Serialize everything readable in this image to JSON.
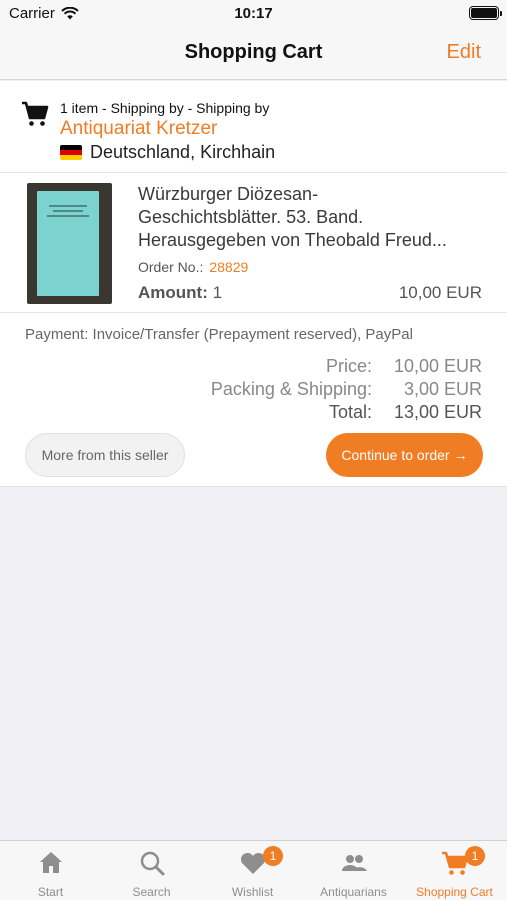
{
  "status_bar": {
    "carrier": "Carrier",
    "time": "10:17"
  },
  "nav": {
    "title": "Shopping Cart",
    "edit_label": "Edit"
  },
  "seller": {
    "summary": "1 item - Shipping by - Shipping by",
    "name": "Antiquariat Kretzer",
    "location": "Deutschland, Kirchhain",
    "flag_colors": [
      "#000000",
      "#dd0000",
      "#ffce00"
    ]
  },
  "item": {
    "title_lines": [
      "Würzburger Diözesan-",
      "Geschichtsblätter. 53. Band.",
      "Herausgegeben von Theobald Freud..."
    ],
    "order_label": "Order No.:",
    "order_number": "28829",
    "amount_label": "Amount:",
    "amount_value": "1",
    "price": "10,00 EUR",
    "cover_color": "#7dd3d0"
  },
  "payment": {
    "text": "Payment: Invoice/Transfer (Prepayment reserved), PayPal"
  },
  "totals": {
    "price_label": "Price:",
    "price_value": "10,00 EUR",
    "shipping_label": "Packing & Shipping:",
    "shipping_value": "3,00 EUR",
    "total_label": "Total:",
    "total_value": "13,00 EUR"
  },
  "buttons": {
    "more_from_seller": "More from this seller",
    "continue_to_order": "Continue to order",
    "continue_arrow": "→"
  },
  "tabs": [
    {
      "label": "Start",
      "icon": "home-icon"
    },
    {
      "label": "Search",
      "icon": "search-icon"
    },
    {
      "label": "Wishlist",
      "icon": "heart-icon",
      "badge": "1"
    },
    {
      "label": "Antiquarians",
      "icon": "people-icon"
    },
    {
      "label": "Shopping Cart",
      "icon": "cart-icon",
      "badge": "1",
      "active": true
    }
  ],
  "colors": {
    "accent": "#f07c24",
    "tab_inactive": "#8e8e8e"
  }
}
